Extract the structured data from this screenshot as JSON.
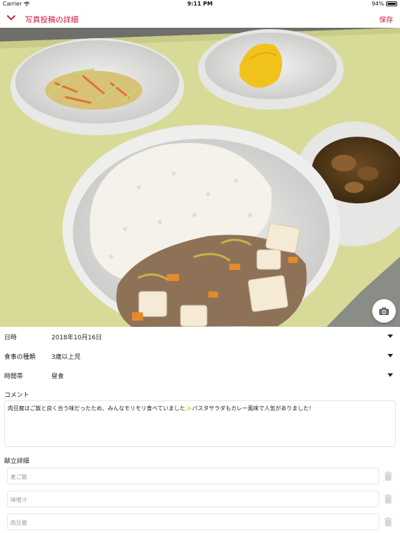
{
  "status_bar": {
    "carrier": "Carrier",
    "time": "9:11 PM",
    "battery": "94%"
  },
  "nav": {
    "title": "写真投稿の詳細",
    "save_label": "保存",
    "back_icon": "chevron-down-icon"
  },
  "photo": {
    "camera_icon": "camera-icon"
  },
  "fields": {
    "date": {
      "label": "日時",
      "value": "2018年10月16日"
    },
    "meal_type": {
      "label": "食事の種類",
      "value": "3歳以上児"
    },
    "time_slot": {
      "label": "時間帯",
      "value": "昼食"
    }
  },
  "comment": {
    "label": "コメント",
    "text": "肉豆腐はご飯と良く合う味だったため、みんなモリモリ食べていました✨パスタサラダもカレー風味で人気がありました！"
  },
  "menu": {
    "label": "献立詳細",
    "items": [
      "麦ご飯",
      "味噌汁",
      "肉豆腐"
    ]
  },
  "colors": {
    "accent": "#c8173a",
    "tray": "#d9dc9a"
  }
}
